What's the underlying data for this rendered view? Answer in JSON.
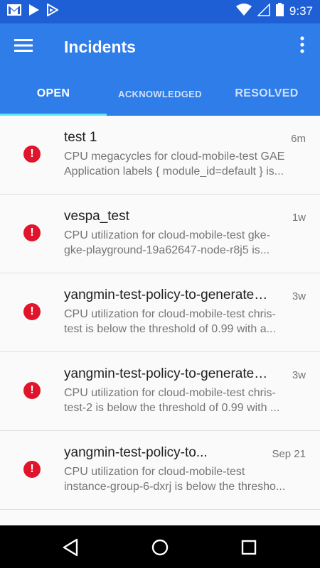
{
  "status_bar": {
    "time": "9:37",
    "left_icons": [
      "gmail-icon",
      "play-store-icon",
      "play-store-outline-icon"
    ],
    "right_icons": [
      "wifi-icon",
      "signal-icon",
      "battery-icon"
    ]
  },
  "app_bar": {
    "title": "Incidents",
    "menu_icon": "hamburger-menu-icon",
    "more_icon": "more-vert-icon"
  },
  "tabs": [
    {
      "label": "OPEN",
      "active": true
    },
    {
      "label": "ACKNOWLEDGED",
      "active": false
    },
    {
      "label": "RESOLVED",
      "active": false
    }
  ],
  "incidents": [
    {
      "name": "test 1",
      "time": "6m",
      "line1": "CPU megacycles for cloud-mobile-test GAE",
      "line2": "Application labels { module_id=default } is..."
    },
    {
      "name": "vespa_test",
      "time": "1w",
      "line1": "CPU utilization for cloud-mobile-test gke-",
      "line2": "gke-playground-19a62647-node-r8j5 is..."
    },
    {
      "name": "yangmin-test-policy-to-generates...",
      "time": "3w",
      "line1": "CPU utilization for cloud-mobile-test chris-",
      "line2": "test is below the threshold of 0.99 with a..."
    },
    {
      "name": "yangmin-test-policy-to-generates...",
      "time": "3w",
      "line1": "CPU utilization for cloud-mobile-test chris-",
      "line2": "test-2 is below the threshold of 0.99 with ..."
    },
    {
      "name": "yangmin-test-policy-to...",
      "time": "Sep 21",
      "line1": "CPU utilization for cloud-mobile-test",
      "line2": "instance-group-6-dxrj is below the thresho..."
    }
  ],
  "colors": {
    "primary": "#2f7de8",
    "status_bar": "#1e5fd6",
    "tab_indicator": "#5ee6f5",
    "alert": "#e0152b"
  },
  "nav_bar": [
    "back-icon",
    "home-icon",
    "recents-icon"
  ]
}
